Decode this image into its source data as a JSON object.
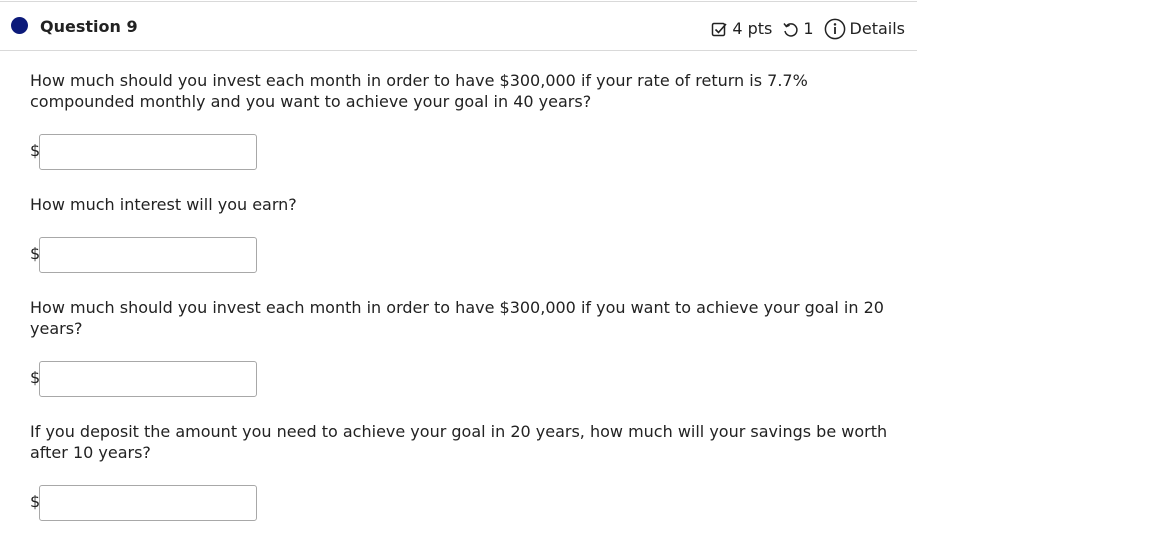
{
  "header": {
    "title": "Question 9",
    "points": "4 pts",
    "attempts": "1",
    "details": "Details"
  },
  "questions": [
    {
      "text": "How much should you invest each month in order to have $300,000 if your rate of return is 7.7% compounded monthly and you want to achieve your goal in 40 years?",
      "prefix": "$",
      "value": ""
    },
    {
      "text": "How much interest will you earn?",
      "prefix": "$",
      "value": ""
    },
    {
      "text": "How much should you invest each month in order to have $300,000 if you want to achieve your goal in 20 years?",
      "prefix": "$",
      "value": ""
    },
    {
      "text": "If you deposit the amount you need to achieve your goal in 20 years, how much will your savings be worth after 10 years?",
      "prefix": "$",
      "value": ""
    }
  ],
  "colors": {
    "dot": "#0c1a7a",
    "divider": "#d9d9d9",
    "input_border": "#a8a8a8"
  }
}
